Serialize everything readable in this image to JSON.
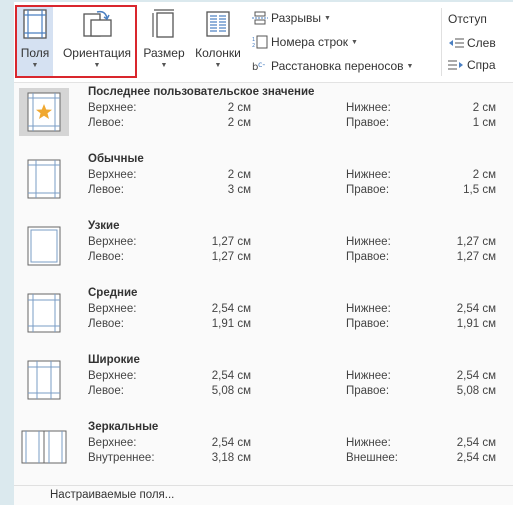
{
  "ribbon": {
    "margins_label": "Поля",
    "orientation_label": "Ориентация",
    "size_label": "Размер",
    "columns_label": "Колонки",
    "breaks_label": "Разрывы",
    "line_numbers_label": "Номера строк",
    "hyphenation_label": "Расстановка переносов",
    "indent_label": "Отступ",
    "indent_left_label": "Слев",
    "indent_right_label": "Спра",
    "highlight_color": "#d9262d"
  },
  "presets": [
    {
      "title": "Последнее пользовательское значение",
      "icon": "margin-star-icon",
      "selected": true,
      "top_label": "Верхнее:",
      "top_value": "2 см",
      "bottom_label": "Нижнее:",
      "bottom_value": "2 см",
      "left_label": "Левое:",
      "left_value": "2 см",
      "right_label": "Правое:",
      "right_value": "1 см"
    },
    {
      "title": "Обычные",
      "icon": "margin-normal-icon",
      "selected": false,
      "top_label": "Верхнее:",
      "top_value": "2 см",
      "bottom_label": "Нижнее:",
      "bottom_value": "2 см",
      "left_label": "Левое:",
      "left_value": "3 см",
      "right_label": "Правое:",
      "right_value": "1,5 см"
    },
    {
      "title": "Узкие",
      "icon": "margin-narrow-icon",
      "selected": false,
      "top_label": "Верхнее:",
      "top_value": "1,27 см",
      "bottom_label": "Нижнее:",
      "bottom_value": "1,27 см",
      "left_label": "Левое:",
      "left_value": "1,27 см",
      "right_label": "Правое:",
      "right_value": "1,27 см"
    },
    {
      "title": "Средние",
      "icon": "margin-moderate-icon",
      "selected": false,
      "top_label": "Верхнее:",
      "top_value": "2,54 см",
      "bottom_label": "Нижнее:",
      "bottom_value": "2,54 см",
      "left_label": "Левое:",
      "left_value": "1,91 см",
      "right_label": "Правое:",
      "right_value": "1,91 см"
    },
    {
      "title": "Широкие",
      "icon": "margin-wide-icon",
      "selected": false,
      "top_label": "Верхнее:",
      "top_value": "2,54 см",
      "bottom_label": "Нижнее:",
      "bottom_value": "2,54 см",
      "left_label": "Левое:",
      "left_value": "5,08 см",
      "right_label": "Правое:",
      "right_value": "5,08 см"
    },
    {
      "title": "Зеркальные",
      "icon": "margin-mirrored-icon",
      "selected": false,
      "top_label": "Верхнее:",
      "top_value": "2,54 см",
      "bottom_label": "Нижнее:",
      "bottom_value": "2,54 см",
      "left_label": "Внутреннее:",
      "left_value": "3,18 см",
      "right_label": "Внешнее:",
      "right_value": "2,54 см"
    }
  ],
  "custom_margins_label": "Настраиваемые поля..."
}
